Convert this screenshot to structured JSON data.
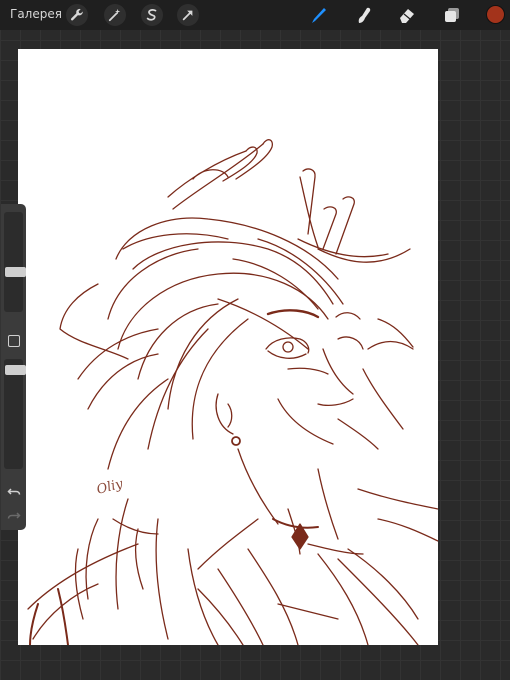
{
  "topbar": {
    "gallery_label": "Галерея",
    "left_tools": [
      {
        "icon": "wrench-icon",
        "name": "actions"
      },
      {
        "icon": "magic-wand-icon",
        "name": "adjustments"
      },
      {
        "icon": "selection-icon",
        "name": "selection"
      },
      {
        "icon": "transform-arrow-icon",
        "name": "transform"
      }
    ],
    "right_tools": [
      {
        "icon": "brush-icon",
        "name": "brush",
        "active": true
      },
      {
        "icon": "smudge-icon",
        "name": "smudge"
      },
      {
        "icon": "eraser-icon",
        "name": "eraser"
      },
      {
        "icon": "layers-icon",
        "name": "layers"
      }
    ],
    "current_color": "#a3331b"
  },
  "canvas": {
    "background": "#ffffff",
    "stroke_color": "#7a2a1a",
    "signature_text": "Oliy"
  },
  "sidebar": {
    "brush_size_slider": {
      "level": 0.6
    },
    "opacity_slider": {
      "level": 0.2
    }
  },
  "colors": {
    "accent_blue": "#1e90ff",
    "topbar": "#1f1f1f",
    "grid_bg": "#2a2a2a"
  }
}
